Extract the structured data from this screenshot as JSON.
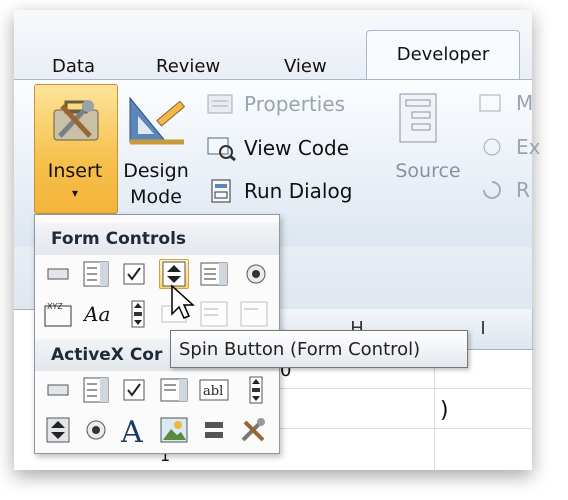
{
  "tabs": [
    {
      "label": "Data"
    },
    {
      "label": "Review"
    },
    {
      "label": "View"
    },
    {
      "label": "Developer",
      "active": true
    }
  ],
  "ribbon": {
    "insert": {
      "label": "Insert",
      "arrow": "▾"
    },
    "design_mode": {
      "line1": "Design",
      "line2": "Mode"
    },
    "properties": {
      "label": "Properties"
    },
    "view_code": {
      "label": "View Code"
    },
    "run_dialog": {
      "label": "Run Dialog"
    },
    "source": {
      "label": "Source"
    },
    "partial_labels": [
      "M",
      "Ex",
      "R"
    ]
  },
  "columns": [
    "H",
    "I"
  ],
  "cells": {
    "right_paren": ")",
    "fragment_mid": "0",
    "fragment_bottom": "1"
  },
  "insert_menu": {
    "form_controls_title": "Form Controls",
    "activex_title": "ActiveX Cor",
    "hovered_control": "spin-button"
  },
  "tooltip": {
    "text": "Spin Button (Form Control)"
  },
  "colors": {
    "accent_insert": "#f6c04c",
    "ribbon_bg": "#e4ecf5",
    "tab_border": "#a9b7c9"
  }
}
